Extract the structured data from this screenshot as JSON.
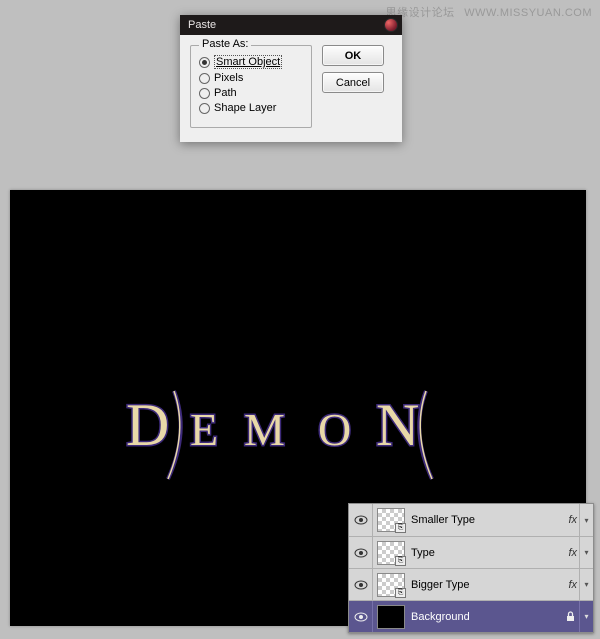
{
  "watermark": {
    "left": "思缘设计论坛",
    "right": "WWW.MISSYUAN.COM"
  },
  "dialog": {
    "title": "Paste",
    "legend": "Paste As:",
    "options": [
      {
        "label": "Smart Object",
        "checked": true,
        "focused": true
      },
      {
        "label": "Pixels",
        "checked": false,
        "focused": false
      },
      {
        "label": "Path",
        "checked": false,
        "focused": false
      },
      {
        "label": "Shape Layer",
        "checked": false,
        "focused": false
      }
    ],
    "ok": "OK",
    "cancel": "Cancel"
  },
  "artwork": {
    "letters": [
      "D",
      "E",
      "M",
      "O",
      "N"
    ]
  },
  "layers_panel": {
    "fx_label": "fx",
    "rows": [
      {
        "name": "Smaller Type",
        "thumb": "checker",
        "fx": true,
        "selected": false
      },
      {
        "name": "Type",
        "thumb": "checker",
        "fx": true,
        "selected": false
      },
      {
        "name": "Bigger Type",
        "thumb": "checker",
        "fx": true,
        "selected": false
      },
      {
        "name": "Background",
        "thumb": "black",
        "fx": false,
        "selected": true,
        "locked": true
      }
    ]
  }
}
